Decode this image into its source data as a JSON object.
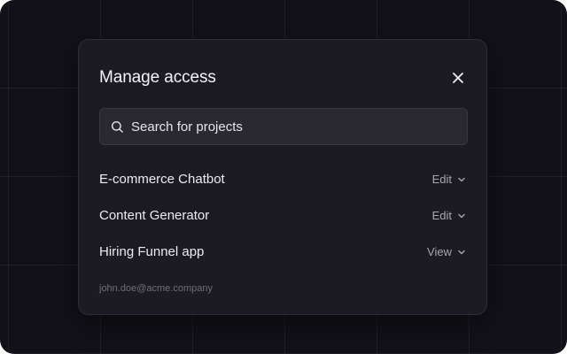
{
  "modal": {
    "title": "Manage access",
    "close_icon": "close-icon"
  },
  "search": {
    "placeholder": "Search for projects",
    "value": "",
    "icon": "search-icon"
  },
  "projects": [
    {
      "name": "E-commerce Chatbot",
      "permission": "Edit"
    },
    {
      "name": "Content Generator",
      "permission": "Edit"
    },
    {
      "name": "Hiring Funnel app",
      "permission": "View"
    }
  ],
  "footer": {
    "email": "john.doe@acme.company"
  },
  "colors": {
    "background": "#121118",
    "modal": "#1c1b23",
    "input": "#2a2932",
    "text_primary": "#ececf0",
    "text_muted": "#a8a7b1"
  }
}
